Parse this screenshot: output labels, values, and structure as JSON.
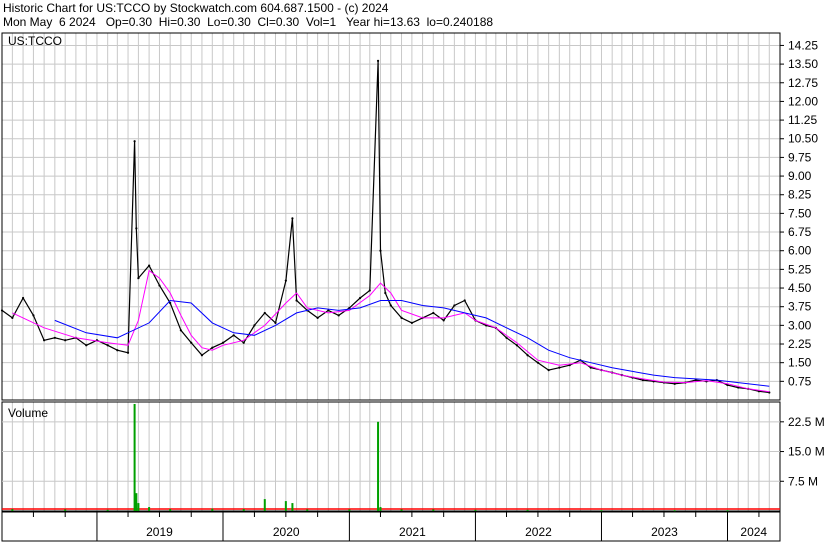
{
  "header": {
    "line1": "Historic Chart for US:TCCO by Stockwatch.com 604.687.1500 - (c) 2024",
    "line2": "Mon May  6 2024   Op=0.30  Hi=0.30  Lo=0.30  Cl=0.30  Vol=1   Year hi=13.63  lo=0.240188"
  },
  "colors": {
    "price": "#000000",
    "ma_short": "#ff00ff",
    "ma_long": "#0000ff",
    "volume": "#00a000",
    "grid": "#c8c8c8",
    "down_price": "#ff0000"
  },
  "chart_data": [
    {
      "type": "line",
      "title": "US:TCCO",
      "ylim": [
        0,
        14.75
      ],
      "yticks": [
        "14.25",
        "13.50",
        "12.75",
        "12.00",
        "11.25",
        "10.50",
        "9.75",
        "9.00",
        "8.25",
        "7.50",
        "6.75",
        "6.00",
        "5.25",
        "4.50",
        "3.75",
        "3.00",
        "2.25",
        "1.50",
        "0.75"
      ],
      "x_labels": [
        "2019",
        "2020",
        "2021",
        "2022",
        "2023",
        "2024"
      ],
      "x_range": [
        "2018-04",
        "2024-06"
      ],
      "series": [
        {
          "points": [
            [
              "2018-04",
              3.6
            ],
            [
              "2018-05",
              3.3
            ],
            [
              "2018-06",
              4.1
            ],
            [
              "2018-07",
              3.4
            ],
            [
              "2018-08",
              2.4
            ],
            [
              "2018-09",
              2.5
            ],
            [
              "2018-10",
              2.4
            ],
            [
              "2018-11",
              2.5
            ],
            [
              "2018-12",
              2.2
            ],
            [
              "2019-01",
              2.4
            ],
            [
              "2019-02",
              2.2
            ],
            [
              "2019-03",
              2.0
            ],
            [
              "2019-04",
              1.9
            ],
            [
              "2019-04-20",
              10.4
            ],
            [
              "2019-04-25",
              6.9
            ],
            [
              "2019-05",
              4.9
            ],
            [
              "2019-06",
              5.4
            ],
            [
              "2019-07",
              4.6
            ],
            [
              "2019-08",
              3.9
            ],
            [
              "2019-09",
              2.8
            ],
            [
              "2019-10",
              2.3
            ],
            [
              "2019-11",
              1.8
            ],
            [
              "2019-12",
              2.1
            ],
            [
              "2020-01",
              2.3
            ],
            [
              "2020-02",
              2.6
            ],
            [
              "2020-03",
              2.3
            ],
            [
              "2020-04",
              3.0
            ],
            [
              "2020-05",
              3.5
            ],
            [
              "2020-06",
              3.1
            ],
            [
              "2020-07",
              4.8
            ],
            [
              "2020-07-20",
              7.3
            ],
            [
              "2020-08",
              4.0
            ],
            [
              "2020-09",
              3.6
            ],
            [
              "2020-10",
              3.3
            ],
            [
              "2020-11",
              3.6
            ],
            [
              "2020-12",
              3.4
            ],
            [
              "2021-01",
              3.7
            ],
            [
              "2021-02",
              4.1
            ],
            [
              "2021-03",
              4.4
            ],
            [
              "2021-03-25",
              13.63
            ],
            [
              "2021-04",
              6.0
            ],
            [
              "2021-04-15",
              4.3
            ],
            [
              "2021-05",
              3.8
            ],
            [
              "2021-06",
              3.3
            ],
            [
              "2021-07",
              3.1
            ],
            [
              "2021-08",
              3.3
            ],
            [
              "2021-09",
              3.5
            ],
            [
              "2021-10",
              3.2
            ],
            [
              "2021-11",
              3.8
            ],
            [
              "2021-12",
              4.0
            ],
            [
              "2022-01",
              3.2
            ],
            [
              "2022-02",
              3.0
            ],
            [
              "2022-03",
              2.9
            ],
            [
              "2022-04",
              2.5
            ],
            [
              "2022-05",
              2.2
            ],
            [
              "2022-06",
              1.8
            ],
            [
              "2022-07",
              1.5
            ],
            [
              "2022-08",
              1.2
            ],
            [
              "2022-09",
              1.3
            ],
            [
              "2022-10",
              1.4
            ],
            [
              "2022-11",
              1.6
            ],
            [
              "2022-12",
              1.3
            ],
            [
              "2023-01",
              1.2
            ],
            [
              "2023-02",
              1.1
            ],
            [
              "2023-03",
              1.0
            ],
            [
              "2023-04",
              0.9
            ],
            [
              "2023-05",
              0.8
            ],
            [
              "2023-06",
              0.75
            ],
            [
              "2023-07",
              0.7
            ],
            [
              "2023-08",
              0.65
            ],
            [
              "2023-09",
              0.7
            ],
            [
              "2023-10",
              0.8
            ],
            [
              "2023-11",
              0.75
            ],
            [
              "2023-12",
              0.8
            ],
            [
              "2024-01",
              0.6
            ],
            [
              "2024-02",
              0.5
            ],
            [
              "2024-03",
              0.45
            ],
            [
              "2024-04",
              0.35
            ],
            [
              "2024-05",
              0.3
            ]
          ]
        },
        {
          "points": [
            [
              "2018-05",
              3.5
            ],
            [
              "2018-08",
              2.9
            ],
            [
              "2018-11",
              2.5
            ],
            [
              "2019-02",
              2.3
            ],
            [
              "2019-04",
              2.2
            ],
            [
              "2019-05",
              3.2
            ],
            [
              "2019-06",
              5.2
            ],
            [
              "2019-07",
              4.9
            ],
            [
              "2019-08",
              4.3
            ],
            [
              "2019-09",
              3.4
            ],
            [
              "2019-10",
              2.6
            ],
            [
              "2019-11",
              2.1
            ],
            [
              "2019-12",
              2.0
            ],
            [
              "2020-01",
              2.2
            ],
            [
              "2020-03",
              2.4
            ],
            [
              "2020-05",
              3.0
            ],
            [
              "2020-07",
              3.9
            ],
            [
              "2020-08",
              4.3
            ],
            [
              "2020-09",
              3.7
            ],
            [
              "2020-11",
              3.5
            ],
            [
              "2021-01",
              3.6
            ],
            [
              "2021-03",
              4.2
            ],
            [
              "2021-04",
              4.7
            ],
            [
              "2021-05",
              4.3
            ],
            [
              "2021-06",
              3.6
            ],
            [
              "2021-08",
              3.3
            ],
            [
              "2021-10",
              3.3
            ],
            [
              "2021-12",
              3.5
            ],
            [
              "2022-01",
              3.2
            ],
            [
              "2022-03",
              2.9
            ],
            [
              "2022-05",
              2.3
            ],
            [
              "2022-07",
              1.6
            ],
            [
              "2022-09",
              1.4
            ],
            [
              "2022-11",
              1.5
            ],
            [
              "2023-01",
              1.2
            ],
            [
              "2023-03",
              1.0
            ],
            [
              "2023-05",
              0.85
            ],
            [
              "2023-07",
              0.72
            ],
            [
              "2023-09",
              0.7
            ],
            [
              "2023-11",
              0.78
            ],
            [
              "2024-01",
              0.65
            ],
            [
              "2024-03",
              0.45
            ],
            [
              "2024-05",
              0.33
            ]
          ]
        },
        {
          "points": [
            [
              "2018-09",
              3.2
            ],
            [
              "2018-12",
              2.7
            ],
            [
              "2019-03",
              2.5
            ],
            [
              "2019-06",
              3.1
            ],
            [
              "2019-08",
              4.0
            ],
            [
              "2019-10",
              3.9
            ],
            [
              "2019-12",
              3.1
            ],
            [
              "2020-02",
              2.7
            ],
            [
              "2020-04",
              2.6
            ],
            [
              "2020-06",
              3.0
            ],
            [
              "2020-08",
              3.5
            ],
            [
              "2020-10",
              3.7
            ],
            [
              "2020-12",
              3.6
            ],
            [
              "2021-02",
              3.7
            ],
            [
              "2021-04",
              4.0
            ],
            [
              "2021-06",
              4.0
            ],
            [
              "2021-08",
              3.8
            ],
            [
              "2021-10",
              3.7
            ],
            [
              "2021-12",
              3.5
            ],
            [
              "2022-02",
              3.3
            ],
            [
              "2022-04",
              2.9
            ],
            [
              "2022-06",
              2.5
            ],
            [
              "2022-08",
              2.0
            ],
            [
              "2022-10",
              1.7
            ],
            [
              "2022-12",
              1.5
            ],
            [
              "2023-02",
              1.3
            ],
            [
              "2023-04",
              1.15
            ],
            [
              "2023-06",
              1.0
            ],
            [
              "2023-08",
              0.9
            ],
            [
              "2023-10",
              0.85
            ],
            [
              "2023-12",
              0.8
            ],
            [
              "2024-02",
              0.7
            ],
            [
              "2024-05",
              0.55
            ]
          ]
        }
      ]
    },
    {
      "type": "bar",
      "title": "Volume",
      "ylim": [
        0,
        27.5
      ],
      "yticks": [
        "22.5 M",
        "15.0 M",
        "7.5 M"
      ],
      "bars": [
        [
          "2018-05",
          0.5
        ],
        [
          "2018-10",
          0.4
        ],
        [
          "2019-02",
          0.3
        ],
        [
          "2019-04-20",
          27
        ],
        [
          "2019-04-25",
          4.5
        ],
        [
          "2019-05",
          2.0
        ],
        [
          "2019-06",
          1.0
        ],
        [
          "2019-08",
          0.5
        ],
        [
          "2019-12",
          0.6
        ],
        [
          "2020-03",
          0.5
        ],
        [
          "2020-05",
          3.0
        ],
        [
          "2020-07",
          2.5
        ],
        [
          "2020-07-20",
          2.0
        ],
        [
          "2020-09",
          0.4
        ],
        [
          "2021-01",
          0.4
        ],
        [
          "2021-03-25",
          22.5
        ],
        [
          "2021-04",
          1.0
        ],
        [
          "2021-06",
          0.4
        ],
        [
          "2021-09",
          0.4
        ],
        [
          "2022-01",
          0.3
        ],
        [
          "2022-06",
          0.3
        ],
        [
          "2023-01",
          0.2
        ],
        [
          "2023-08",
          0.2
        ],
        [
          "2024-01",
          0.2
        ]
      ]
    }
  ]
}
